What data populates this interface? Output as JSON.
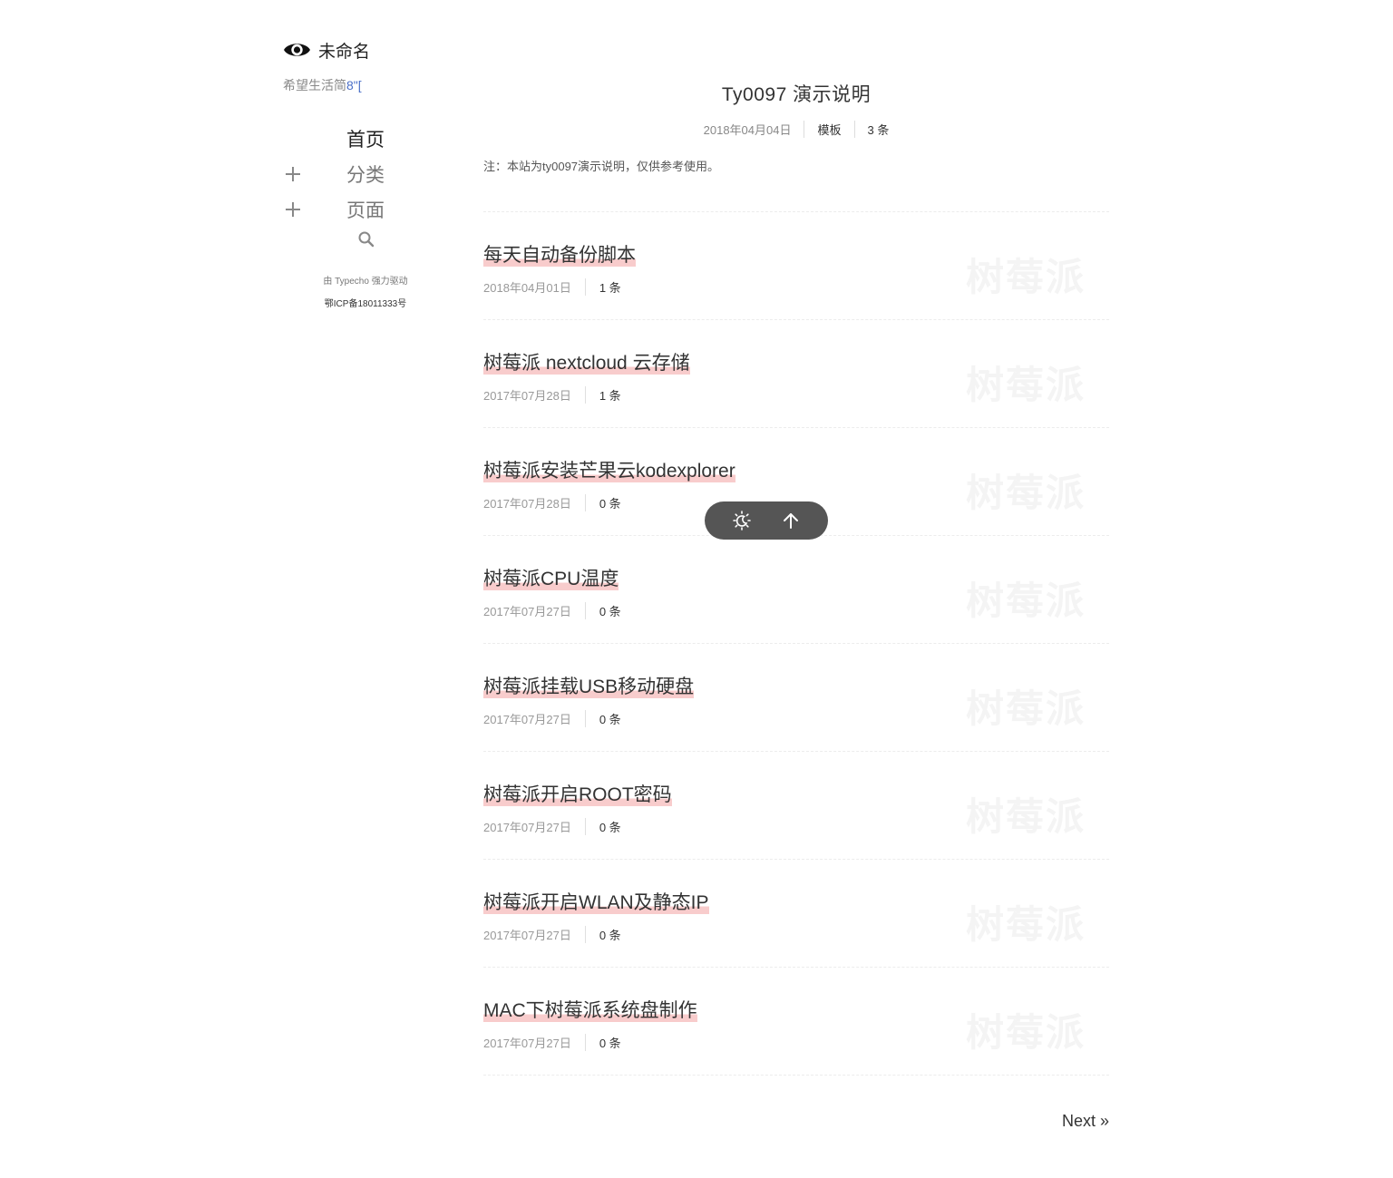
{
  "site": {
    "name": "未命名",
    "tagline": "希望生活简",
    "tagline_suffix": "8\"["
  },
  "nav": {
    "items": [
      {
        "label": "首页",
        "active": true,
        "expandable": false
      },
      {
        "label": "分类",
        "active": false,
        "expandable": true
      },
      {
        "label": "页面",
        "active": false,
        "expandable": true
      }
    ],
    "search_icon": "search-icon"
  },
  "footer": {
    "powered_prefix": "由",
    "powered_brand": "Typecho",
    "powered_suffix": "强力驱动",
    "icp": "鄂ICP备18011333号"
  },
  "pinned_post": {
    "title": "Ty0097 演示说明",
    "date": "2018年04月04日",
    "category": "模板",
    "comments": "3 条",
    "note": "注：本站为ty0097演示说明，仅供参考使用。"
  },
  "posts": [
    {
      "title": "每天自动备份脚本",
      "date": "2018年04月01日",
      "comments": "1 条",
      "watermark": "树莓派"
    },
    {
      "title": "树莓派 nextcloud 云存储",
      "date": "2017年07月28日",
      "comments": "1 条",
      "watermark": "树莓派"
    },
    {
      "title": "树莓派安装芒果云kodexplorer",
      "date": "2017年07月28日",
      "comments": "0 条",
      "watermark": "树莓派"
    },
    {
      "title": "树莓派CPU温度",
      "date": "2017年07月27日",
      "comments": "0 条",
      "watermark": "树莓派"
    },
    {
      "title": "树莓派挂载USB移动硬盘",
      "date": "2017年07月27日",
      "comments": "0 条",
      "watermark": "树莓派"
    },
    {
      "title": "树莓派开启ROOT密码",
      "date": "2017年07月27日",
      "comments": "0 条",
      "watermark": "树莓派"
    },
    {
      "title": "树莓派开启WLAN及静态IP",
      "date": "2017年07月27日",
      "comments": "0 条",
      "watermark": "树莓派"
    },
    {
      "title": "MAC下树莓派系统盘制作",
      "date": "2017年07月27日",
      "comments": "0 条",
      "watermark": "树莓派"
    }
  ],
  "pagination": {
    "next_label": "Next »"
  },
  "float_bar": {
    "theme_icon": "sun-moon-icon",
    "top_icon": "arrow-up-icon"
  },
  "colors": {
    "title_highlight": "#f8cccc",
    "float_bar_bg": "#555555",
    "tagline_accent": "#4a6fc8"
  }
}
